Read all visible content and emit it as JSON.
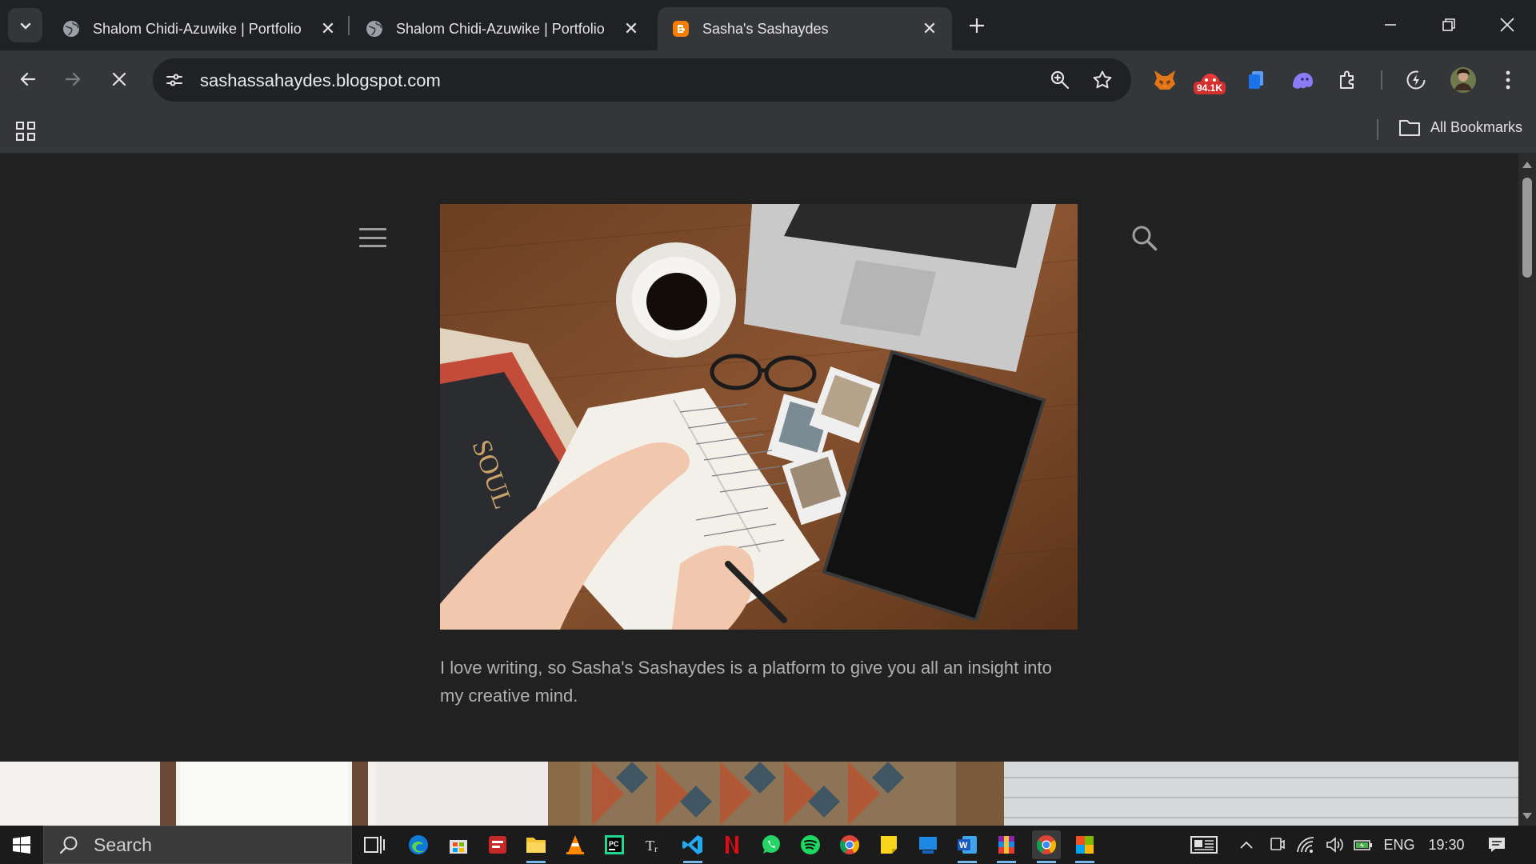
{
  "browser": {
    "tabs": [
      {
        "title": "Shalom Chidi-Azuwike | Portfolio",
        "favicon": "globe-icon",
        "active": false
      },
      {
        "title": "Shalom Chidi-Azuwike | Portfolio",
        "favicon": "globe-icon",
        "active": false
      },
      {
        "title": "Sasha's Sashaydes",
        "favicon": "blogger-icon",
        "active": true
      }
    ],
    "url": "sashassahaydes.blogspot.com",
    "extension_badge": "94.1K",
    "bookmarks_label": "All Bookmarks"
  },
  "page": {
    "blurb": "I love writing, so Sasha's Sashaydes is a platform to give you all an insight into my creative mind."
  },
  "taskbar": {
    "search_label": "Search",
    "language": "ENG",
    "time": "19:30"
  },
  "colors": {
    "chrome_dark": "#202124",
    "toolbar": "#35363a",
    "page_bg": "#212121",
    "blogger_orange": "#f57d00",
    "badge_red": "#d32f2f"
  }
}
